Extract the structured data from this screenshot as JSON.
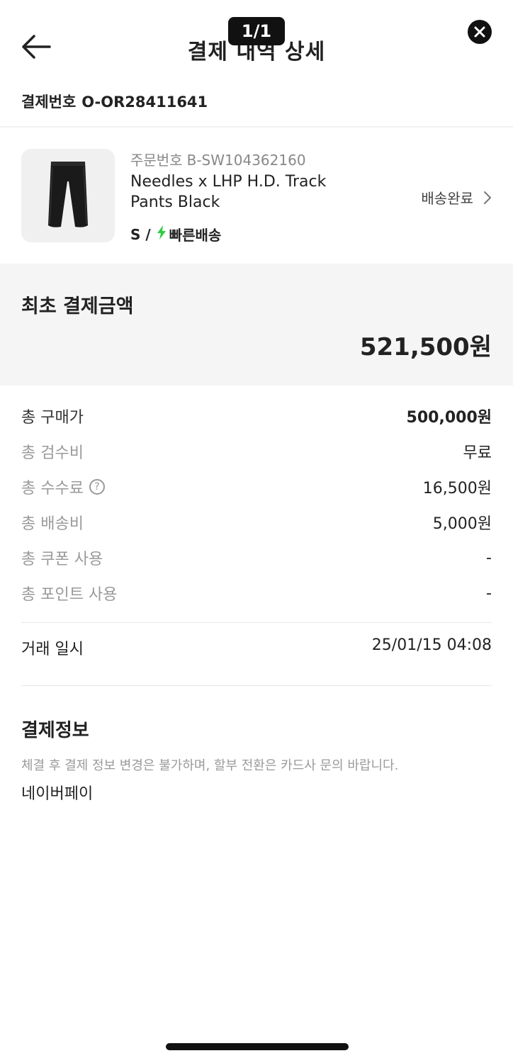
{
  "header": {
    "title": "결제 내역 상세",
    "page_counter": "1/1"
  },
  "payment": {
    "number_label": "결제번호",
    "number_value": "O-OR28411641"
  },
  "product": {
    "order_label": "주문번호",
    "order_value": "B-SW104362160",
    "name": "Needles x LHP H.D. Track Pants Black",
    "size": "S /",
    "shipping": "빠른배송",
    "status": "배송완료"
  },
  "initial_amount": {
    "title": "최초 결제금액",
    "value": "521,500원"
  },
  "breakdown": [
    {
      "key": "총 구매가",
      "value": "500,000원"
    },
    {
      "key": "총 검수비",
      "value": "무료"
    },
    {
      "key": "총 수수료",
      "value": "16,500원"
    },
    {
      "key": "총 배송비",
      "value": "5,000원"
    },
    {
      "key": "총 쿠폰 사용",
      "value": "-"
    },
    {
      "key": "총 포인트 사용",
      "value": "-"
    }
  ],
  "trade": {
    "label": "거래 일시",
    "value": "25/01/15 04:08"
  },
  "payinfo": {
    "title": "결제정보",
    "note": "체결 후 결제 정보 변경은 불가하며, 할부 전환은 카드사 문의 바랍니다.",
    "method": "네이버페이"
  },
  "colors": {
    "accent_bolt": "#2ecc40",
    "text_primary": "#222222",
    "text_muted": "#9a9a9a",
    "panel_bg": "#f5f5f5"
  },
  "icons": {
    "back": "arrow-left-icon",
    "close": "close-icon",
    "status_chevron": "chevron-right-icon",
    "help": "question-circle-icon",
    "shipping": "lightning-bolt-icon"
  }
}
